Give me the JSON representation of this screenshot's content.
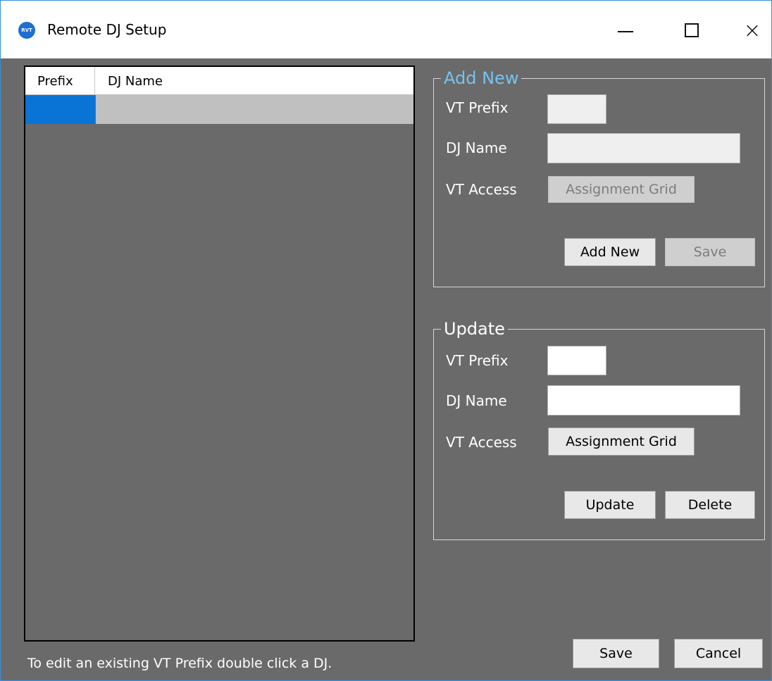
{
  "window": {
    "title": "Remote DJ Setup",
    "icon_text": "RVT",
    "close_glyph": "×"
  },
  "table": {
    "columns": [
      "Prefix",
      "DJ Name"
    ],
    "rows": [
      {
        "prefix": "",
        "dj_name": ""
      }
    ]
  },
  "add_new": {
    "legend": "Add New",
    "vt_prefix_label": "VT Prefix",
    "vt_prefix_value": "",
    "dj_name_label": "DJ Name",
    "dj_name_value": "",
    "vt_access_label": "VT Access",
    "assignment_grid_label": "Assignment Grid",
    "add_new_button": "Add New",
    "save_button": "Save"
  },
  "update": {
    "legend": "Update",
    "vt_prefix_label": "VT Prefix",
    "vt_prefix_value": "",
    "dj_name_label": "DJ Name",
    "dj_name_value": "",
    "vt_access_label": "VT Access",
    "assignment_grid_label": "Assignment Grid",
    "update_button": "Update",
    "delete_button": "Delete"
  },
  "footer": {
    "hint": "To edit an existing VT Prefix double click a DJ.",
    "save_button": "Save",
    "cancel_button": "Cancel"
  },
  "colors": {
    "background": "#6a6a6a",
    "selected_row": "#0a74d6",
    "row_highlight": "#c0c0c0",
    "add_new_legend": "#76c3f0"
  }
}
